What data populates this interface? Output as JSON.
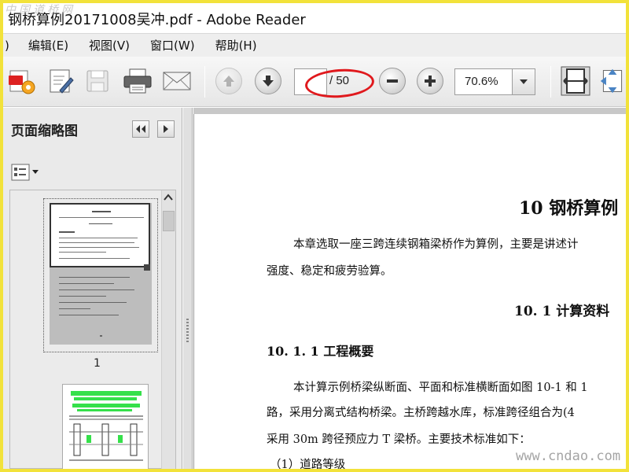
{
  "window": {
    "title": "钢桥算例20171008吴冲.pdf - Adobe Reader",
    "watermark_top": "中国道桥网",
    "watermark_bottom": "www.cndao.com"
  },
  "menubar": {
    "stub": ")",
    "items": [
      "编辑(E)",
      "视图(V)",
      "窗口(W)",
      "帮助(H)"
    ]
  },
  "toolbar": {
    "icons": [
      "create-pdf-icon",
      "sign-icon",
      "save-icon",
      "print-icon",
      "email-icon"
    ],
    "page_total": "/ 50",
    "zoom_value": "70.6%",
    "highlight_color": "#e0191d"
  },
  "leftpane": {
    "title": "页面缩略图",
    "thumb1_label": "1"
  },
  "document": {
    "chapter_title": "10 钢桥算例",
    "para1_line1": "本章选取一座三跨连续钢箱梁桥作为算例，主要是讲述计",
    "para1_line2": "强度、稳定和疲劳验算。",
    "section_title": "10. 1  计算资料",
    "subsection_title": "10. 1. 1  工程概要",
    "para2_line1": "本计算示例桥梁纵断面、平面和标准横断面如图 10-1 和 1",
    "para2_line2": "路，采用分离式结构桥梁。主桥跨越水库，标准跨径组合为(4",
    "para2_line3": "采用 30m 跨径预应力 T 梁桥。主要技术标准如下：",
    "para3": "（1）道路等级"
  }
}
